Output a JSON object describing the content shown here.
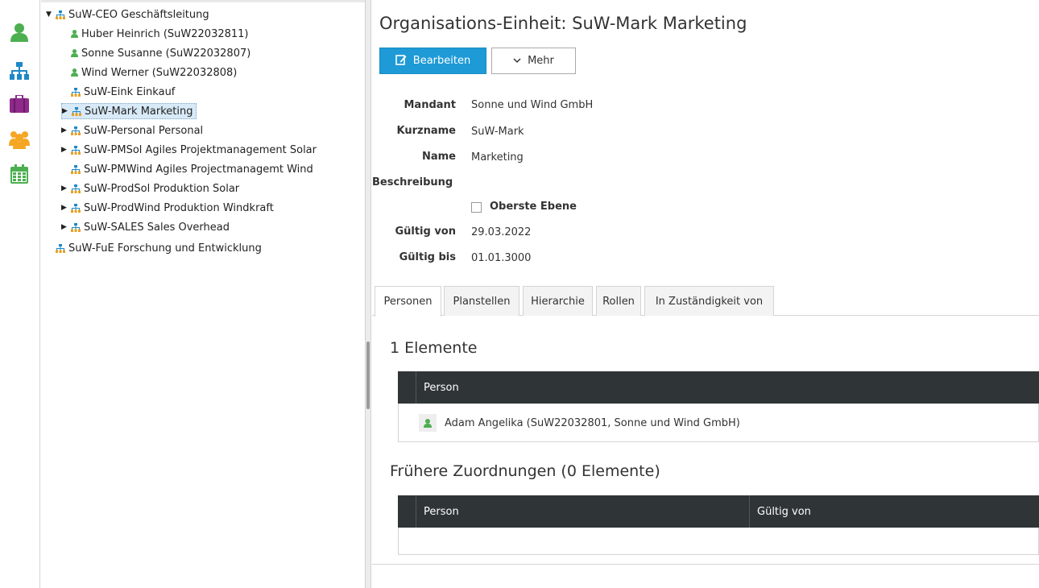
{
  "rail": {
    "items": [
      {
        "name": "person-icon",
        "color": "#4caf50"
      },
      {
        "name": "org-chart-icon",
        "color": "#1e88c7"
      },
      {
        "name": "briefcase-icon",
        "color": "#8e2a8a"
      },
      {
        "name": "group-icon",
        "color": "#f5a623"
      },
      {
        "name": "calendar-icon",
        "color": "#4caf50"
      }
    ]
  },
  "tree": {
    "nodes": [
      {
        "label": "SuW-CEO Geschäftsleitung",
        "type": "org",
        "toggle": "▼"
      },
      {
        "label": "Huber Heinrich (SuW22032811)",
        "type": "person",
        "toggle": ""
      },
      {
        "label": "Sonne Susanne (SuW22032807)",
        "type": "person",
        "toggle": ""
      },
      {
        "label": "Wind Werner (SuW22032808)",
        "type": "person",
        "toggle": ""
      },
      {
        "label": "SuW-Eink Einkauf",
        "type": "org",
        "toggle": ""
      },
      {
        "label": "SuW-Mark Marketing",
        "type": "org",
        "toggle": "▶",
        "selected": true
      },
      {
        "label": "SuW-Personal Personal",
        "type": "org",
        "toggle": "▶"
      },
      {
        "label": "SuW-PMSol Agiles Projektmanagement Solar",
        "type": "org",
        "toggle": "▶"
      },
      {
        "label": "SuW-PMWind Agiles Projectmanagemt Wind",
        "type": "org",
        "toggle": ""
      },
      {
        "label": "SuW-ProdSol Produktion Solar",
        "type": "org",
        "toggle": "▶"
      },
      {
        "label": "SuW-ProdWind Produktion Windkraft",
        "type": "org",
        "toggle": "▶"
      },
      {
        "label": "SuW-SALES Sales Overhead",
        "type": "org",
        "toggle": "▶"
      },
      {
        "label": "SuW-FuE Forschung und Entwicklung",
        "type": "org",
        "toggle": ""
      }
    ]
  },
  "main": {
    "title": "Organisations-Einheit: SuW-Mark Marketing",
    "edit_label": "Bearbeiten",
    "more_label": "Mehr",
    "fields": {
      "mandant_label": "Mandant",
      "mandant_value": "Sonne und Wind GmbH",
      "kurzname_label": "Kurzname",
      "kurzname_value": "SuW-Mark",
      "name_label": "Name",
      "name_value": "Marketing",
      "beschreibung_label": "Beschreibung",
      "oberste_ebene_label": "Oberste Ebene",
      "oberste_ebene_checked": false,
      "gueltig_von_label": "Gültig von",
      "gueltig_von_value": "29.03.2022",
      "gueltig_bis_label": "Gültig bis",
      "gueltig_bis_value": "01.01.3000"
    },
    "tabs": [
      "Personen",
      "Planstellen",
      "Hierarchie",
      "Rollen",
      "In Zuständigkeit von"
    ],
    "active_tab": "Personen",
    "current": {
      "title": "1 Elemente",
      "column": "Person",
      "rows": [
        "Adam Angelika (SuW22032801, Sonne und Wind GmbH)"
      ]
    },
    "former": {
      "title": "Frühere Zuordnungen (0 Elemente)",
      "col_person": "Person",
      "col_valid_from": "Gültig von"
    }
  },
  "colors": {
    "primary": "#1e9ad6",
    "table_header": "#2f3437",
    "person": "#4caf50",
    "org": "#1e88c7",
    "selection": "#d8eaf7"
  }
}
